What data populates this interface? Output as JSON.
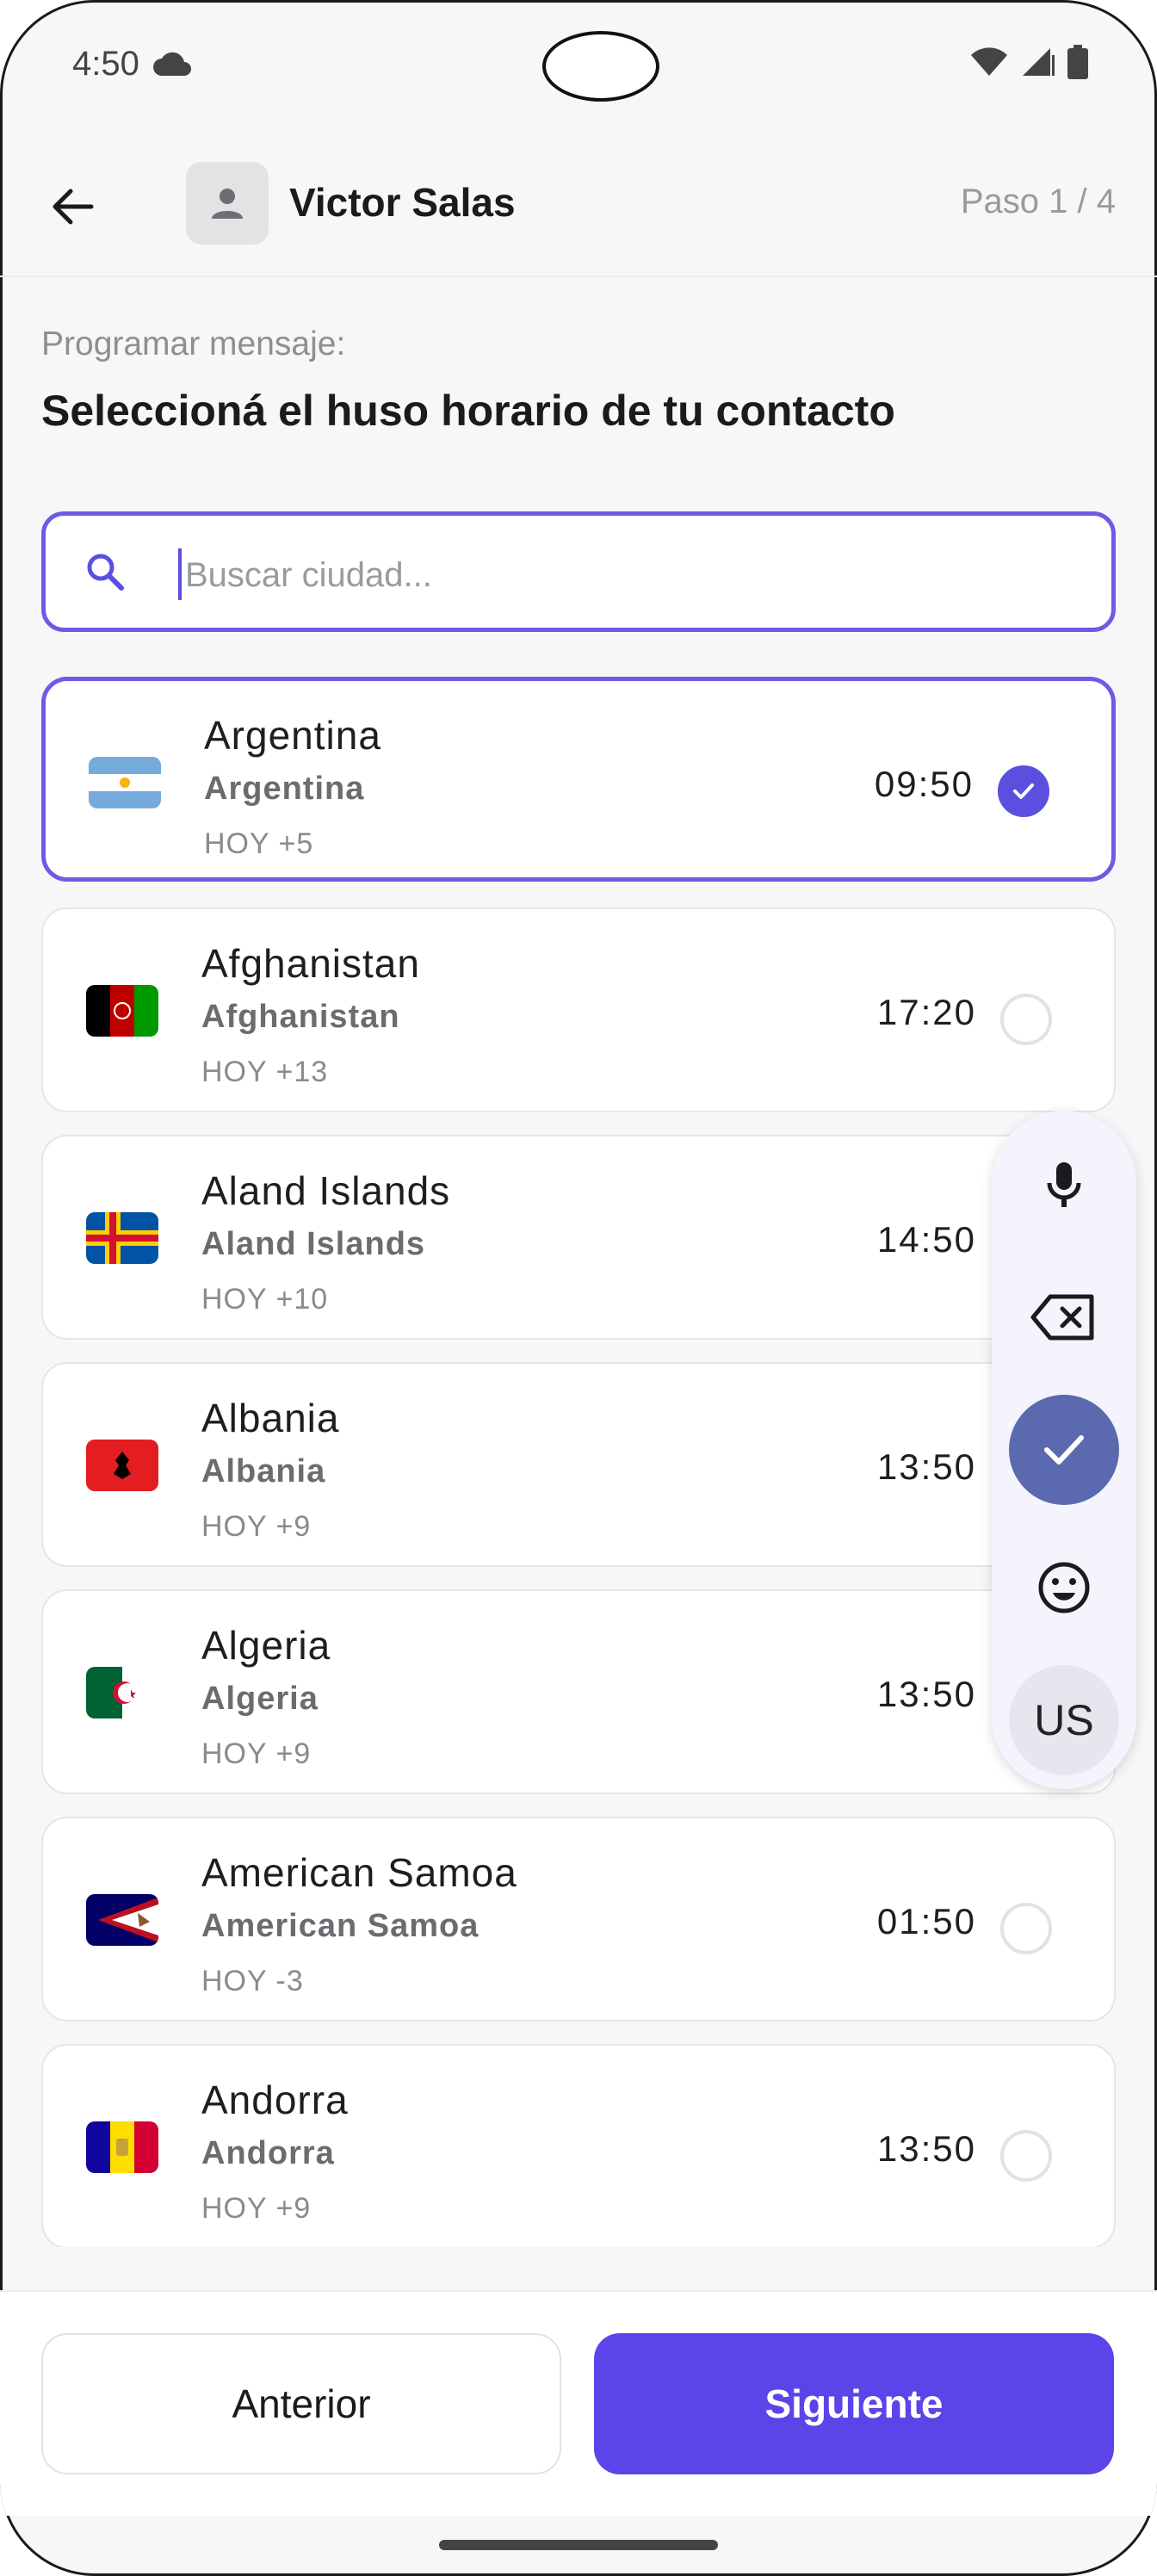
{
  "status_bar": {
    "time": "4:50"
  },
  "header": {
    "contact_name": "Victor Salas",
    "step": "Paso 1 / 4"
  },
  "subtitle": "Programar mensaje:",
  "title": "Seleccioná el huso horario de tu contacto",
  "search": {
    "placeholder": "Buscar ciudad...",
    "value": ""
  },
  "countries": [
    {
      "name": "Argentina",
      "sub": "Argentina",
      "offset": "HOY +5",
      "time": "09:50",
      "selected": true,
      "flag": "argentina"
    },
    {
      "name": "Afghanistan",
      "sub": "Afghanistan",
      "offset": "HOY +13",
      "time": "17:20",
      "selected": false,
      "flag": "afghanistan"
    },
    {
      "name": "Aland Islands",
      "sub": "Aland Islands",
      "offset": "HOY +10",
      "time": "14:50",
      "selected": false,
      "flag": "aland"
    },
    {
      "name": "Albania",
      "sub": "Albania",
      "offset": "HOY +9",
      "time": "13:50",
      "selected": false,
      "flag": "albania"
    },
    {
      "name": "Algeria",
      "sub": "Algeria",
      "offset": "HOY +9",
      "time": "13:50",
      "selected": false,
      "flag": "algeria"
    },
    {
      "name": "American Samoa",
      "sub": "American Samoa",
      "offset": "HOY -3",
      "time": "01:50",
      "selected": false,
      "flag": "american-samoa"
    },
    {
      "name": "Andorra",
      "sub": "Andorra",
      "offset": "HOY +9",
      "time": "13:50",
      "selected": false,
      "flag": "andorra"
    }
  ],
  "keyboard_toolbar": {
    "language": "US",
    "icons": [
      "mic-icon",
      "backspace-icon",
      "check-icon",
      "emoji-icon"
    ]
  },
  "buttons": {
    "previous": "Anterior",
    "next": "Siguiente"
  },
  "colors": {
    "accent": "#5b45e8",
    "selected_border": "#6b5ce6"
  }
}
